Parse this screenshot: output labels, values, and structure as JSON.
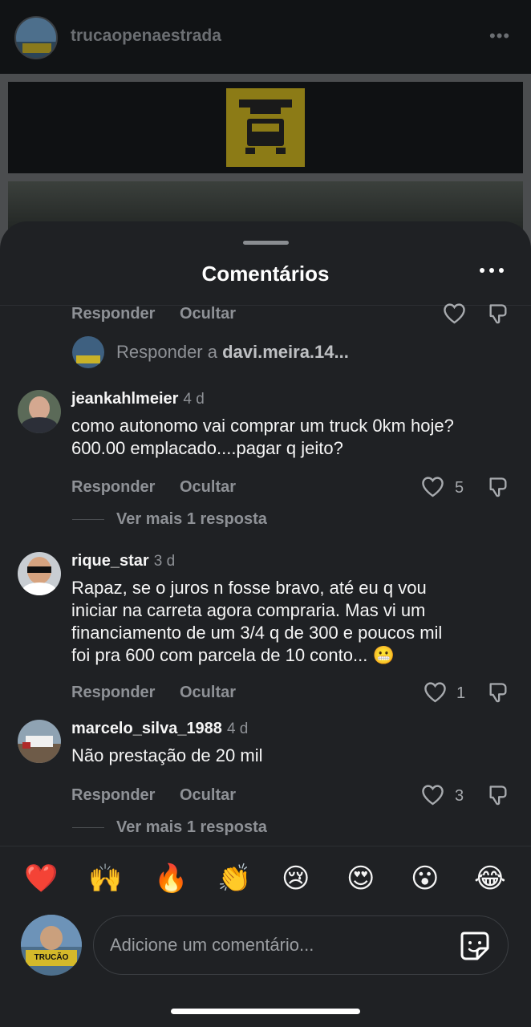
{
  "post_header": {
    "username": "trucaopenaestrada",
    "more_icon": "ellipsis-icon"
  },
  "sheet": {
    "title": "Comentários"
  },
  "top_actions": {
    "reply": "Responder",
    "hide": "Ocultar"
  },
  "reply_to": {
    "prefix": "Responder a ",
    "user": "davi.meira.14..."
  },
  "comments": [
    {
      "username": "jeankahlmeier",
      "time": "4 d",
      "line1": "como autonomo vai comprar um truck  0km hoje?",
      "line2": "600.00 emplacado....pagar q jeito?",
      "reply": "Responder",
      "hide": "Ocultar",
      "likes": "5",
      "more": "Ver mais 1 resposta"
    },
    {
      "username": "rique_star",
      "time": "3 d",
      "line1": "Rapaz, se o juros n fosse bravo, até eu q vou",
      "line2": "iniciar na carreta agora compraria. Mas vi um",
      "line3": "financiamento de um 3/4 q de 300 e poucos mil",
      "line4": "foi pra 600 com parcela de 10 conto... 😬",
      "reply": "Responder",
      "hide": "Ocultar",
      "likes": "1"
    },
    {
      "username": "marcelo_silva_1988",
      "time": "4 d",
      "line1": "Não prestação de 20 mil",
      "reply": "Responder",
      "hide": "Ocultar",
      "likes": "3",
      "more": "Ver mais 1 resposta"
    }
  ],
  "emojis": [
    "❤️",
    "🙌",
    "🔥",
    "👏",
    "😢",
    "😍",
    "😮",
    "😂"
  ],
  "composer": {
    "placeholder": "Adicione um comentário...",
    "sticker_icon": "sticker-icon"
  },
  "avatar_badge": "TRUCÃO"
}
